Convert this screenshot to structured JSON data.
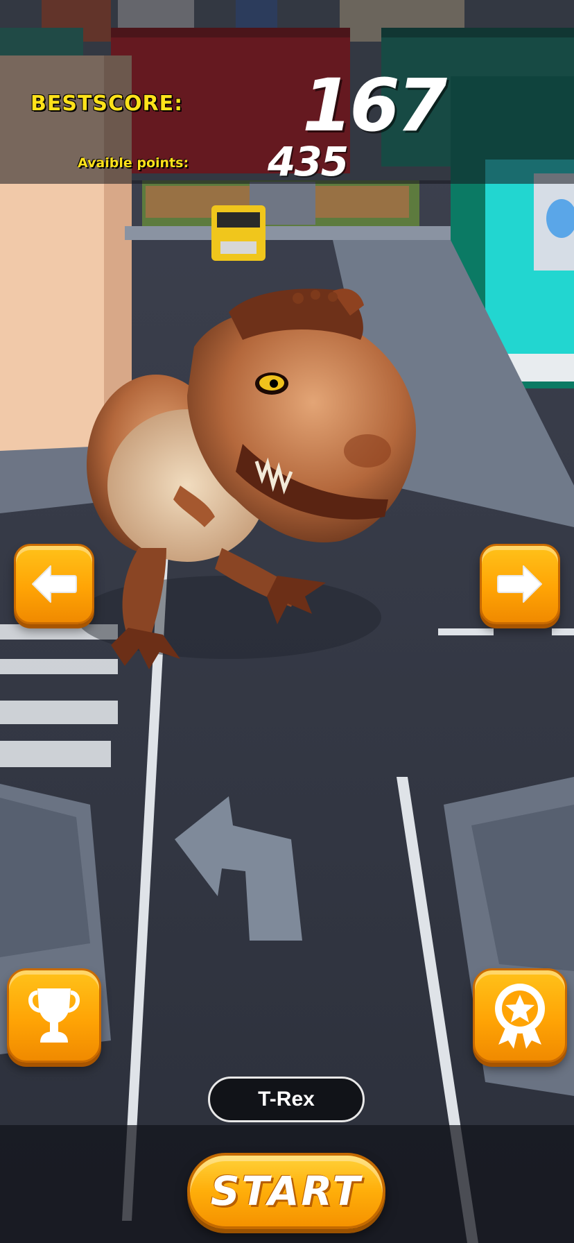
{
  "hud": {
    "best_label": "BESTSCORE:",
    "best_value": "167",
    "points_label": "Avaible points:",
    "points_value": "435"
  },
  "controls": {
    "left_icon": "arrow-left-icon",
    "right_icon": "arrow-right-icon",
    "trophy_icon": "trophy-icon",
    "award_icon": "award-ribbon-icon"
  },
  "character": {
    "name": "T-Rex"
  },
  "start": {
    "label": "START"
  },
  "colors": {
    "accent": "#ffa405",
    "hud_label": "#ffe21a"
  }
}
